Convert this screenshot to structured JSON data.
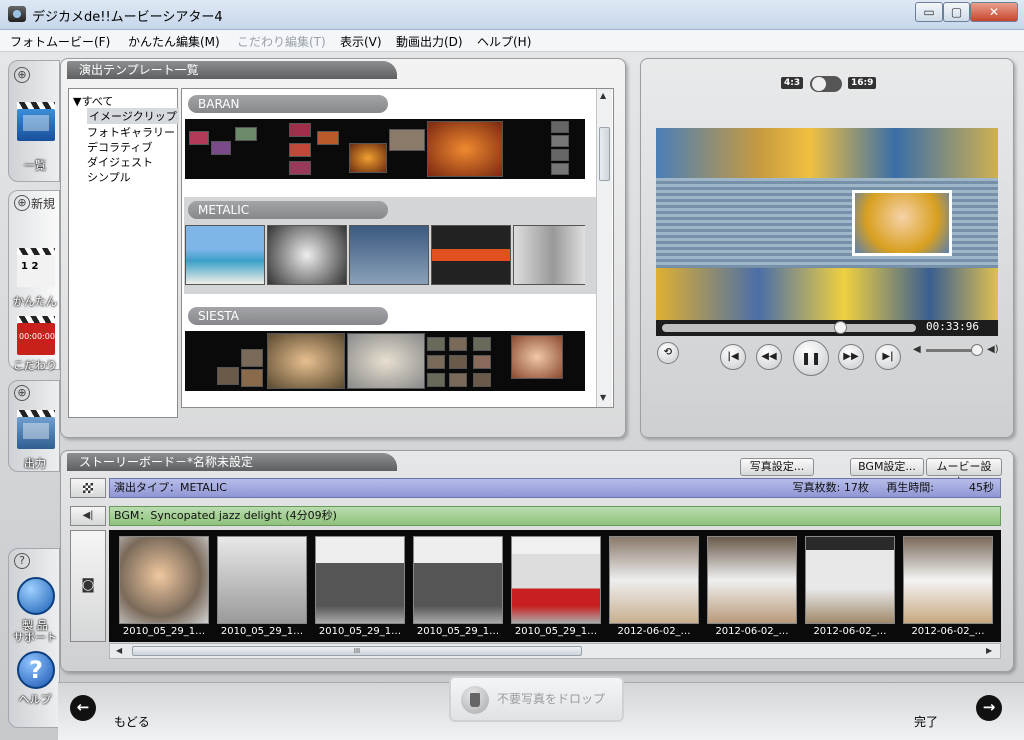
{
  "window": {
    "title": "デジカメde!!ムービーシアター4",
    "min": "▭",
    "max": "▢",
    "close": "✕"
  },
  "menu": [
    {
      "label": "フォトムービー(F)",
      "disabled": false
    },
    {
      "label": "かんたん編集(M)",
      "disabled": false
    },
    {
      "label": "こだわり編集(T)",
      "disabled": true
    },
    {
      "label": "表示(V)",
      "disabled": false
    },
    {
      "label": "動画出力(D)",
      "disabled": false
    },
    {
      "label": "ヘルプ(H)",
      "disabled": false
    }
  ],
  "rail": {
    "list_label": "一覧",
    "new_label": "新規",
    "easy_label": "かんたん",
    "custom_label": "こだわり",
    "output_label": "出力",
    "support_label_1": "製 品",
    "support_label_2": "サポート",
    "help_label": "ヘルプ",
    "clap_counter": "1 2",
    "clap_custom": "00:00:00",
    "plus": "⊕",
    "q": "?"
  },
  "templates": {
    "title": "演出テンプレート一覧",
    "tree_root": "▼すべて",
    "tree_items": [
      "イメージクリップ",
      "フォトギャラリー",
      "デコラティブ",
      "ダイジェスト",
      "シンプル"
    ],
    "selected_tree_item": "イメージクリップ",
    "items": [
      {
        "name": "BARAN",
        "selected": false
      },
      {
        "name": "METALIC",
        "selected": true
      },
      {
        "name": "SIESTA",
        "selected": false
      }
    ]
  },
  "preview": {
    "aspect_a": "4:3",
    "aspect_b": "16:9",
    "time": "00:33:96",
    "seek_position": 0.7,
    "volume": 0.95
  },
  "storyboard": {
    "title": "ストーリーボード－*名称未設定",
    "photo_settings": "写真設定...",
    "bgm_settings": "BGM設定...",
    "movie_settings": "ムービー設定...",
    "type_text": "演出タイプ：METALIC",
    "photo_count": "写真枚数: 17枚",
    "play_time_label": "再生時間:",
    "play_time_value": "45秒",
    "bgm_text": "BGM：Syncopated jazz delight (4分09秒)",
    "photos": [
      {
        "caption": "2010_05_29_1…"
      },
      {
        "caption": "2010_05_29_1…"
      },
      {
        "caption": "2010_05_29_1…"
      },
      {
        "caption": "2010_05_29_1…"
      },
      {
        "caption": "2010_05_29_1…"
      },
      {
        "caption": "2012-06-02_…"
      },
      {
        "caption": "2012-06-02_…"
      },
      {
        "caption": "2012-06-02_…"
      },
      {
        "caption": "2012-06-02_…"
      }
    ],
    "scroll_grip": "III"
  },
  "footer": {
    "back_label": "もどる",
    "done_label": "完了",
    "drop_label": "不要写真をドロップ"
  },
  "colors": {
    "type_row": "#9aa1dc",
    "bgm_row": "#9ccb88",
    "panel": "#e6e7e8",
    "accent": "#1b5fb3"
  }
}
